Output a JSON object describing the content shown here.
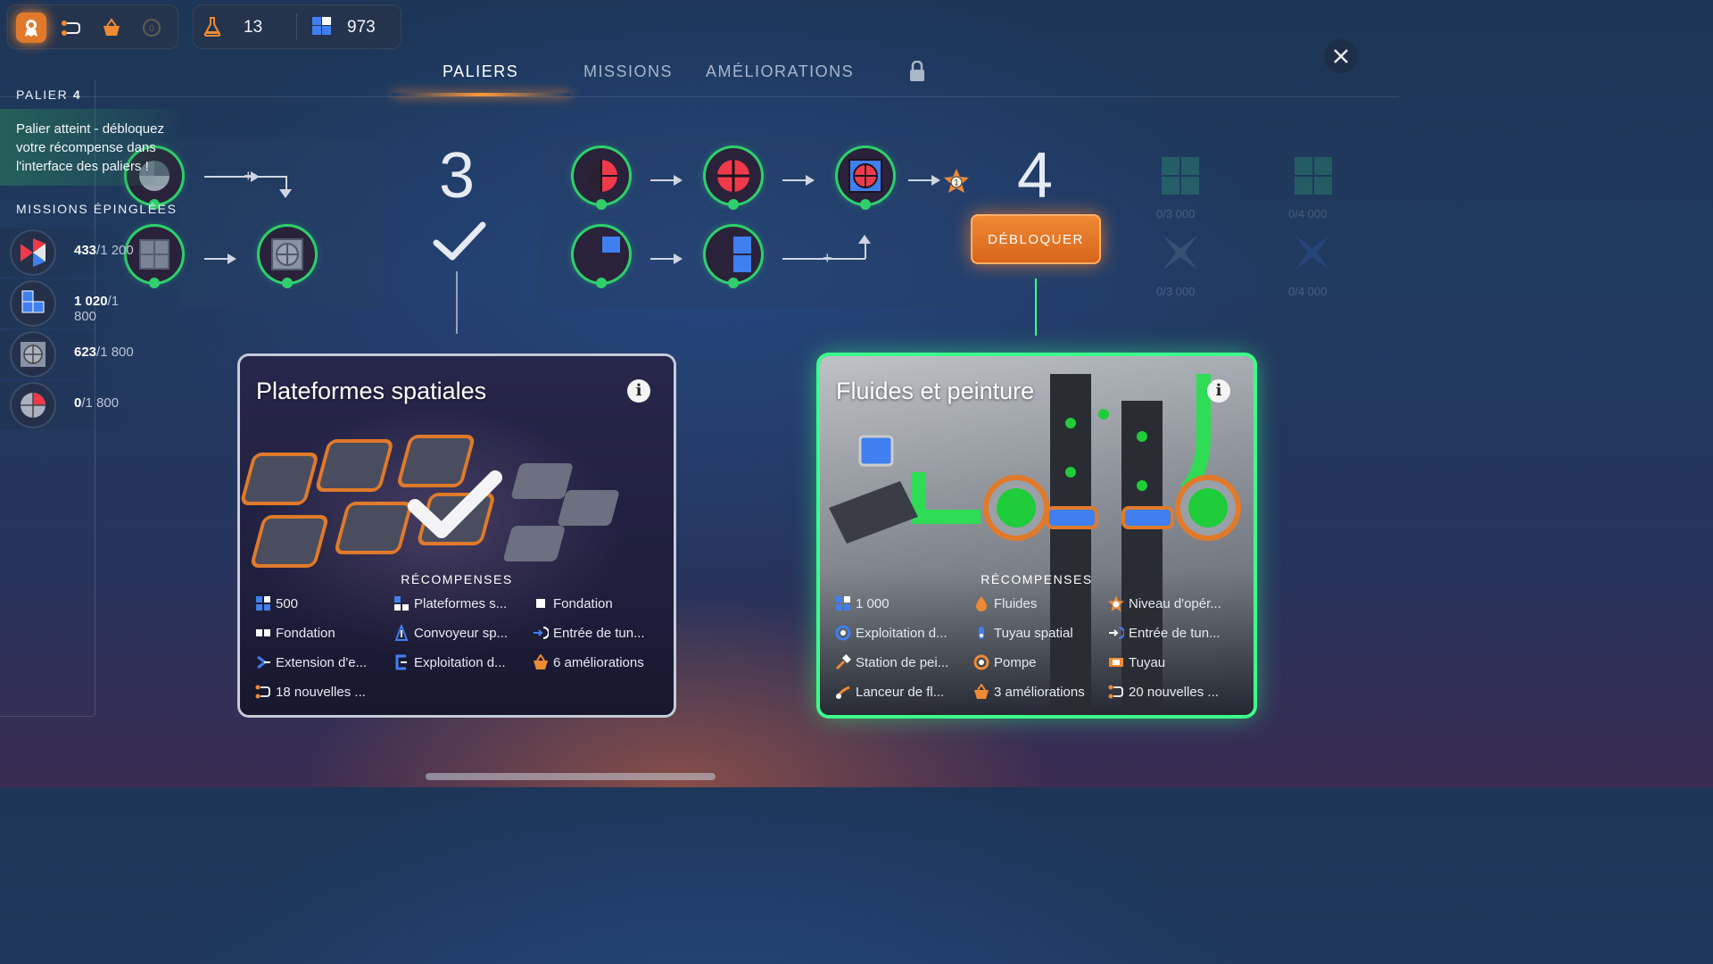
{
  "hud": {
    "icons": [
      "medal-icon",
      "path-icon",
      "basket-icon",
      "operator-icon"
    ],
    "research_count": "13",
    "shapes_count": "973"
  },
  "tabs": [
    {
      "label": "PALIERS",
      "active": true
    },
    {
      "label": "MISSIONS",
      "active": false
    },
    {
      "label": "AMÉLIORATIONS",
      "active": false
    }
  ],
  "left": {
    "palier_label": "PALIER",
    "palier_num": "4",
    "palier_msg": "Palier atteint - débloquez votre récompense dans l'interface des paliers !",
    "pinned_title": "MISSIONS ÉPINGLÉES",
    "pinned": [
      {
        "current": "433",
        "total": "/1 200"
      },
      {
        "current": "1 020",
        "total": "/1 800"
      },
      {
        "current": "623",
        "total": "/1 800"
      },
      {
        "current": "0",
        "total": "/1 800"
      }
    ]
  },
  "tree": {
    "tier3": "3",
    "tier4": "4",
    "unlock_label": "DÉBLOQUER",
    "faded": [
      "0/3 000",
      "0/4 000",
      "0/3 000",
      "0/4 000"
    ]
  },
  "card_left": {
    "title": "Plateformes spatiales",
    "rewards_title": "RÉCOMPENSES",
    "rewards": [
      "500",
      "Plateformes s...",
      "Fondation",
      "Fondation",
      "Convoyeur sp...",
      "Entrée de tun...",
      "Extension d'e...",
      "Exploitation d...",
      "6 améliorations",
      "18 nouvelles ..."
    ]
  },
  "card_right": {
    "title": "Fluides et peinture",
    "rewards_title": "RÉCOMPENSES",
    "rewards": [
      "1 000",
      "Fluides",
      "Niveau d'opér...",
      "Exploitation d...",
      "Tuyau spatial",
      "Entrée de tun...",
      "Station de pei...",
      "Pompe",
      "Tuyau",
      "Lanceur de fl...",
      "3 améliorations",
      "20 nouvelles ..."
    ]
  },
  "colors": {
    "accent": "#e07a2a",
    "green": "#2fcf6c"
  }
}
